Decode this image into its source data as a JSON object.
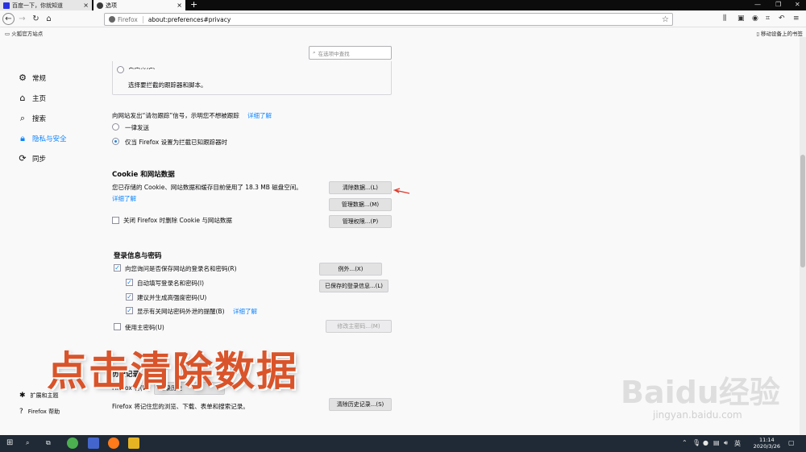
{
  "tabs": [
    {
      "title": "百度一下，你就知道",
      "close": "×"
    },
    {
      "title": "选项",
      "close": "×"
    }
  ],
  "new_tab": "+",
  "window_controls": [
    "—",
    "❐",
    "✕"
  ],
  "nav": {
    "url_brand": "Firefox",
    "url": "about:preferences#privacy"
  },
  "bookmarks": {
    "item": "火狐官方站点",
    "mobile": "移动设备上的书签"
  },
  "search": {
    "placeholder": "在选项中查找"
  },
  "sidebar": {
    "items": [
      {
        "label": "常规",
        "icon": "gear-icon"
      },
      {
        "label": "主页",
        "icon": "home-icon"
      },
      {
        "label": "搜索",
        "icon": "search-icon"
      },
      {
        "label": "隐私与安全",
        "icon": "lock-icon"
      },
      {
        "label": "同步",
        "icon": "sync-icon"
      }
    ],
    "extensions": "扩展和主题",
    "help": "Firefox 帮助"
  },
  "tracking": {
    "custom_label": "自定义(C)",
    "custom_desc": "选择要拦截的跟踪器和脚本。",
    "dnt_text": "向网站发出“请勿跟踪”信号，示明您不想被跟踪",
    "dnt_learn": "详细了解",
    "always": "一律发送",
    "only_when": "仅当 Firefox 设置为拦截已知跟踪器时"
  },
  "cookies": {
    "heading": "Cookie 和网站数据",
    "desc": "您已存储的 Cookie、网站数据和缓存目前使用了 18.3 MB 磁盘空间。",
    "learn": "详细了解",
    "delete_on_close": "关闭 Firefox 时删除 Cookie 与网站数据",
    "clear_btn": "清除数据...(L)",
    "manage_btn": "管理数据...(M)",
    "perm_btn": "管理权限...(P)"
  },
  "logins": {
    "heading": "登录信息与密码",
    "ask_save": "向您询问是否保存网站的登录名和密码(R)",
    "autofill": "自动填写登录名和密码(I)",
    "suggest": "建议并生成高强度密码(U)",
    "breach": "显示有关网站密码外泄的提醒(B)",
    "breach_learn": "详细了解",
    "master": "使用主密码(U)",
    "exceptions_btn": "例外...(X)",
    "saved_btn": "已保存的登录信息...(L)",
    "change_master_btn": "修改主密码...(M)"
  },
  "history": {
    "heading": "历史记录",
    "will_label": "Firefox 将(W)",
    "select_value": "记录历史",
    "desc": "Firefox 将记住您的浏览、下载、表单和搜索记录。",
    "clear_btn": "清除历史记录...(S)"
  },
  "overlay": "点击清除数据",
  "watermark": "Baidu经验",
  "watermark_url": "jingyan.baidu.com",
  "taskbar": {
    "time": "11:14",
    "date": "2020/3/26",
    "ime": "英"
  },
  "colors": {
    "accent": "#0a84ff",
    "overlay": "#d9542a",
    "taskbar": "#1f2a36"
  }
}
